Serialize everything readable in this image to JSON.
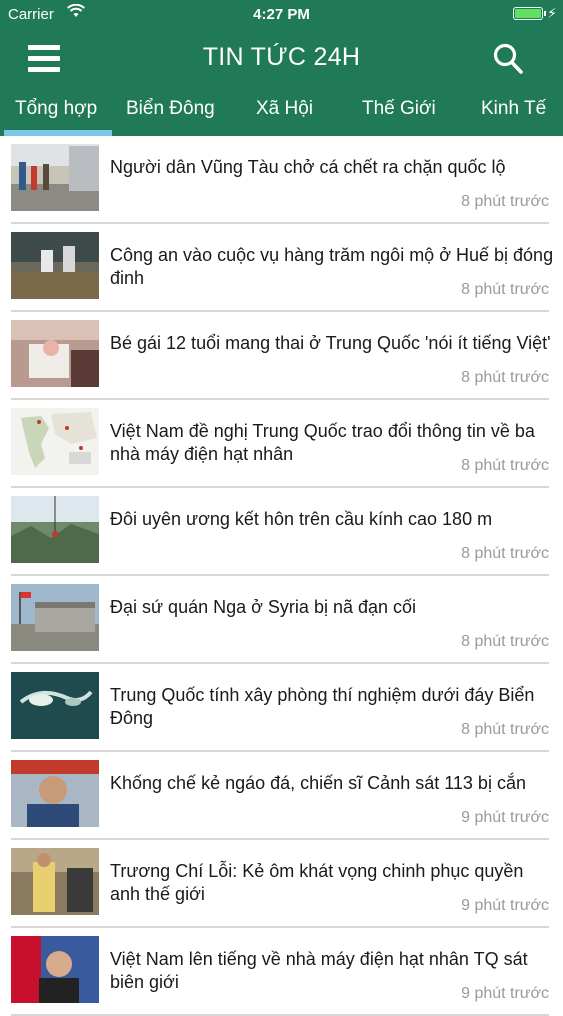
{
  "status_bar": {
    "carrier": "Carrier",
    "time": "4:27 PM",
    "battery_level": 1.0
  },
  "header": {
    "title": "TIN TỨC 24H",
    "menu_icon": "hamburger-menu-icon",
    "search_icon": "search-icon"
  },
  "tabs": [
    {
      "label": "Tổng hợp",
      "selected": true
    },
    {
      "label": "Biển Đông",
      "selected": false
    },
    {
      "label": "Xã Hội",
      "selected": false
    },
    {
      "label": "Thế Giới",
      "selected": false
    },
    {
      "label": "Kinh Tế",
      "selected": false
    }
  ],
  "colors": {
    "brand_green": "#217a57",
    "tab_indicator": "#7ec6e6",
    "time_text": "#9a9a9a"
  },
  "news": [
    {
      "headline": "Người dân Vũng Tàu chở cá chết ra chặn quốc lộ",
      "time": "8 phút trước"
    },
    {
      "headline": "Công an vào cuộc vụ hàng trăm ngôi mộ ở Huế bị đóng đinh",
      "time": "8 phút trước"
    },
    {
      "headline": "Bé gái 12 tuổi mang thai ở Trung Quốc 'nói ít tiếng Việt'",
      "time": "8 phút trước"
    },
    {
      "headline": "Việt Nam đề nghị Trung Quốc trao đổi thông tin về ba nhà máy điện hạt nhân",
      "time": "8 phút trước"
    },
    {
      "headline": "Đôi uyên ương kết hôn trên cầu kính cao 180 m",
      "time": "8 phút trước"
    },
    {
      "headline": "Đại sứ quán Nga ở Syria bị nã đạn cối",
      "time": "8 phút trước"
    },
    {
      "headline": "Trung Quốc tính xây phòng thí nghiệm dưới đáy Biển Đông",
      "time": "8 phút trước"
    },
    {
      "headline": "Khống chế kẻ ngáo đá, chiến sĩ Cảnh sát 113 bị cắn",
      "time": "9 phút trước"
    },
    {
      "headline": "Trương Chí Lỗi: Kẻ ôm khát vọng chinh phục quyền anh thế giới",
      "time": "9 phút trước"
    },
    {
      "headline": "Việt Nam lên tiếng về nhà máy điện hạt nhân TQ sát biên giới",
      "time": "9 phút trước"
    }
  ]
}
